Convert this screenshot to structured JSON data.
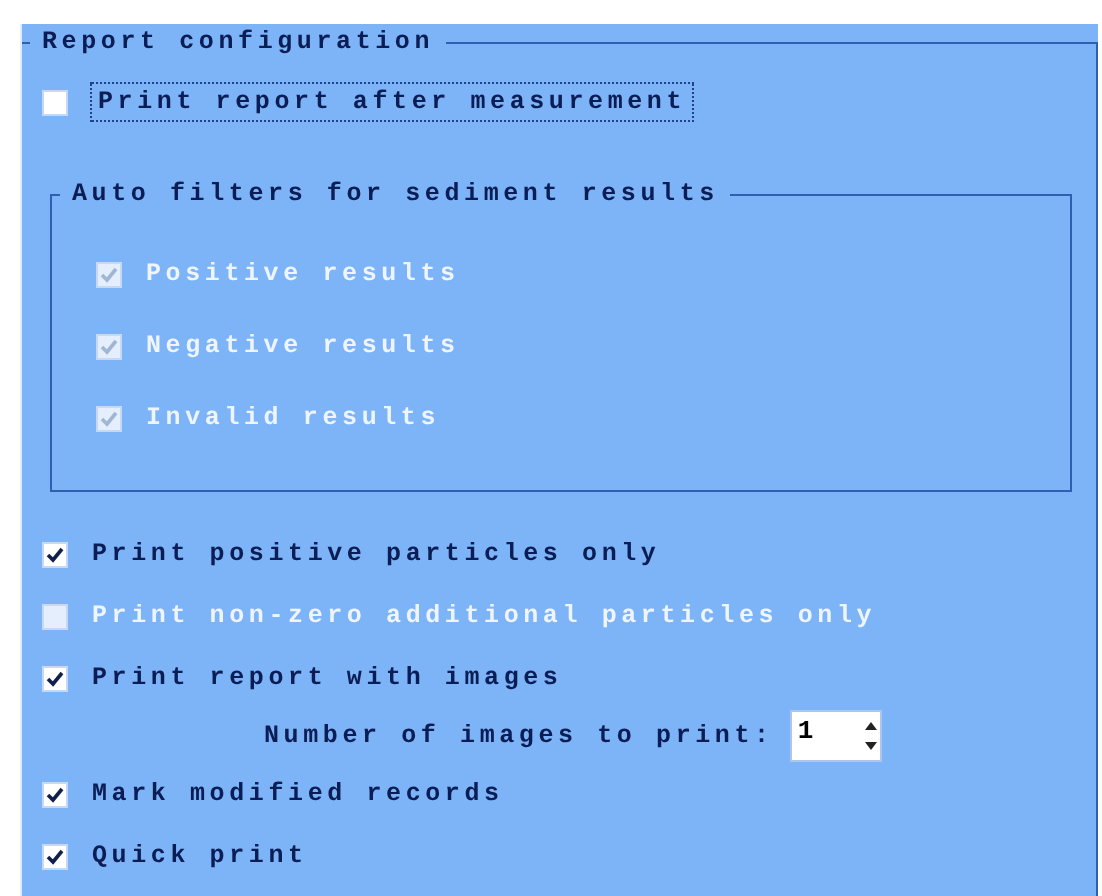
{
  "report_configuration": {
    "title": "Report configuration",
    "print_after_measurement": {
      "label": "Print report after measurement",
      "checked": false,
      "disabled": false,
      "focused": true
    },
    "auto_filters": {
      "title": "Auto filters for sediment results",
      "items": [
        {
          "label": "Positive results",
          "checked": true,
          "disabled": true
        },
        {
          "label": "Negative results",
          "checked": true,
          "disabled": true
        },
        {
          "label": "Invalid results",
          "checked": true,
          "disabled": true
        }
      ]
    },
    "options": [
      {
        "kind": "checkbox",
        "label": "Print positive particles only",
        "checked": true,
        "disabled": false
      },
      {
        "kind": "checkbox",
        "label": "Print non-zero additional particles only",
        "checked": false,
        "disabled": true
      },
      {
        "kind": "checkbox",
        "label": "Print report with images",
        "checked": true,
        "disabled": false
      },
      {
        "kind": "spinner",
        "label": "Number of images to print:",
        "value": "1"
      },
      {
        "kind": "checkbox",
        "label": "Mark modified records",
        "checked": true,
        "disabled": false
      },
      {
        "kind": "checkbox",
        "label": "Quick print",
        "checked": true,
        "disabled": false
      }
    ]
  }
}
